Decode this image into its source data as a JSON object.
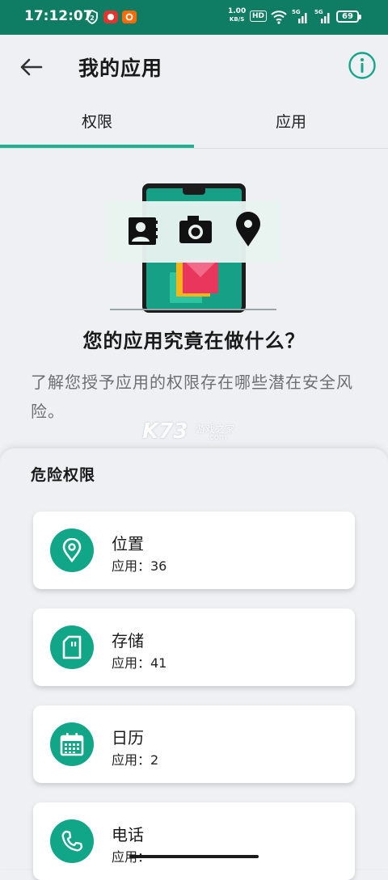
{
  "status_bar": {
    "time": "17:12:07",
    "net_speed_value": "1.00",
    "net_speed_unit": "KB/S",
    "hd_label": "HD",
    "signal1_label": "5G",
    "signal2_label": "5G",
    "battery": "69",
    "background": "#0f7d63"
  },
  "app_bar": {
    "title": "我的应用",
    "back_icon": "arrow-left-icon",
    "info_icon": "info-icon"
  },
  "tabs": [
    {
      "label": "权限",
      "active": true
    },
    {
      "label": "应用",
      "active": false
    }
  ],
  "hero": {
    "heading": "您的应用究竟在做什么？",
    "description": "了解您授予应用的权限存在哪些潜在安全风险。",
    "icons": [
      "contacts-icon",
      "camera-icon",
      "location-pin-icon"
    ]
  },
  "watermark": {
    "logo": "K73",
    "text": "游戏之家",
    "sub": ".com"
  },
  "dangerous_permissions": {
    "title": "危险权限",
    "items": [
      {
        "name": "位置",
        "count": "应用：36",
        "icon": "location-icon"
      },
      {
        "name": "存储",
        "count": "应用：41",
        "icon": "sd-card-icon"
      },
      {
        "name": "日历",
        "count": "应用：2",
        "icon": "calendar-icon"
      },
      {
        "name": "电话",
        "count": "应用：",
        "icon": "phone-icon"
      }
    ]
  },
  "colors": {
    "accent": "#1ab493",
    "icon_circle": "#12a688",
    "background": "#eef0f3"
  }
}
